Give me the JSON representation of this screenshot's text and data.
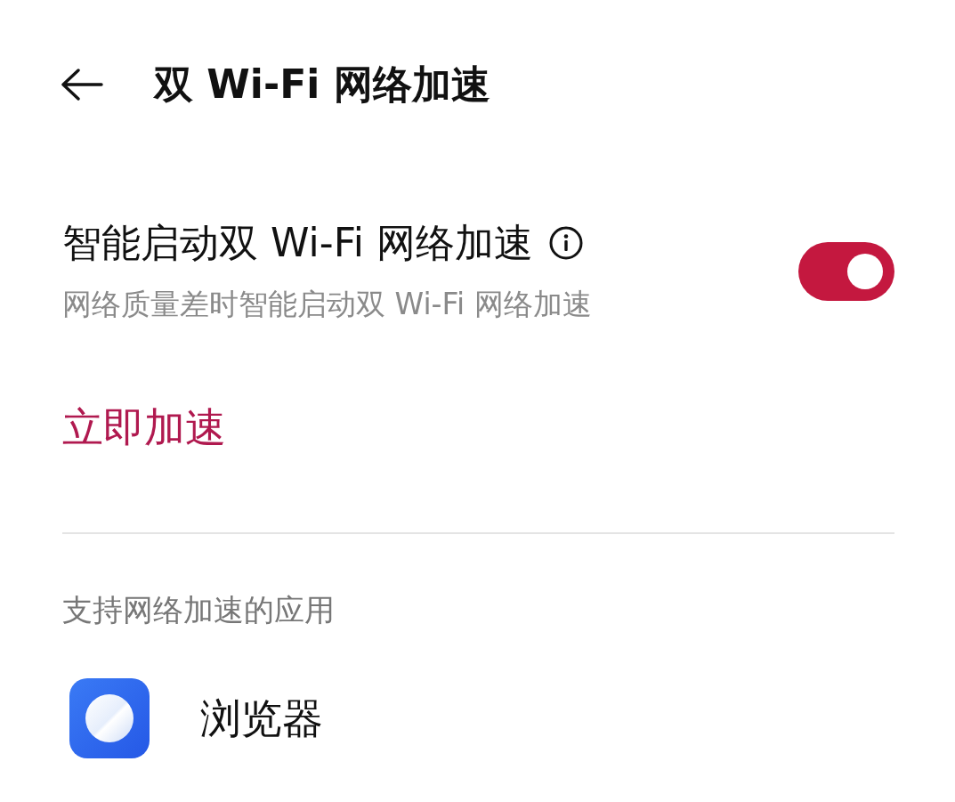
{
  "header": {
    "title": "双 Wi-Fi 网络加速"
  },
  "settings": [
    {
      "kind": "toggle",
      "title": "智能启动双 Wi-Fi 网络加速",
      "subtitle": "网络质量差时智能启动双 Wi-Fi 网络加速",
      "on": true
    },
    {
      "kind": "action",
      "title": "立即加速"
    }
  ],
  "apps_section": {
    "heading": "支持网络加速的应用",
    "apps": [
      {
        "name": "浏览器"
      }
    ]
  }
}
